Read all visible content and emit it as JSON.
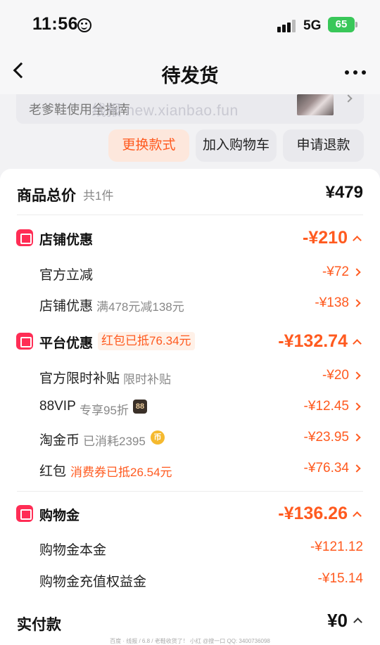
{
  "status_bar": {
    "time": "11:56",
    "network": "5G",
    "battery": "65"
  },
  "nav": {
    "title": "待发货"
  },
  "guide": {
    "text": "老爹鞋使用全指南",
    "watermark": "线报 new.xianbao.fun"
  },
  "actions": {
    "change_style": "更换款式",
    "add_cart": "加入购物车",
    "refund": "申请退款"
  },
  "summary": {
    "total_label": "商品总价",
    "total_count": "共1件",
    "total_value": "¥479",
    "shop_discount": {
      "label": "店铺优惠",
      "value": "-¥210",
      "items": [
        {
          "label": "官方立减",
          "note": "",
          "value": "-¥72"
        },
        {
          "label": "店铺优惠",
          "note": "满478元减138元",
          "value": "-¥138"
        }
      ]
    },
    "platform_discount": {
      "label": "平台优惠",
      "tag": "红包已抵76.34元",
      "value": "-¥132.74",
      "items": [
        {
          "label": "官方限时补贴",
          "note": "限时补贴",
          "value": "-¥20"
        },
        {
          "label": "88VIP",
          "note": "专享95折",
          "badge": "88",
          "value": "-¥12.45"
        },
        {
          "label": "淘金币",
          "note": "已消耗2395",
          "coin": "币",
          "value": "-¥23.95"
        },
        {
          "label": "红包",
          "note": "消费券已抵26.54元",
          "value": "-¥76.34"
        }
      ]
    },
    "shopping_credit": {
      "label": "购物金",
      "value": "-¥136.26",
      "items": [
        {
          "label": "购物金本金",
          "value": "-¥121.12"
        },
        {
          "label": "购物金充值权益金",
          "value": "-¥15.14"
        }
      ]
    },
    "paid_label": "实付款",
    "paid_value": "¥0"
  },
  "footer": "百度 · 线报 / 6.8 / 老鞋收货了！ 小红 @搜一口 QQ: 3400736098"
}
